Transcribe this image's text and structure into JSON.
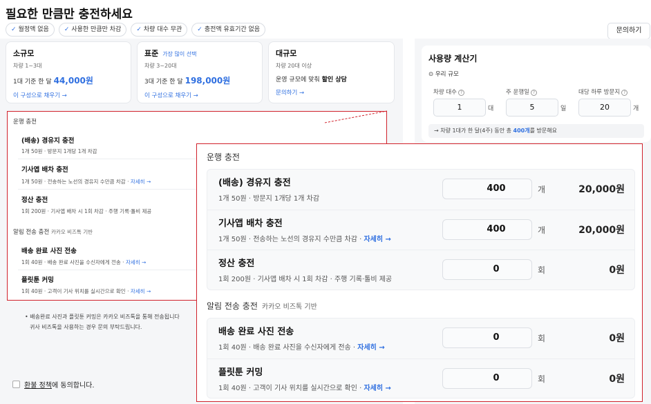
{
  "header": {
    "title": "필요한 만큼만 충전하세요",
    "inquiry_button": "문의하기",
    "chips": [
      "월정액 없음",
      "사용한 만큼만 차감",
      "차량 대수 무관",
      "충전액 유효기간 없음"
    ]
  },
  "plans": [
    {
      "name": "소규모",
      "badge": "",
      "sub": "차량 1~3대",
      "price_prefix": "1대 기준 한 달",
      "price": "44,000원",
      "price_strong": "",
      "link": "이 구성으로 채우기 →"
    },
    {
      "name": "표준",
      "badge": "가장 많이 선택",
      "sub": "차량 3~20대",
      "price_prefix": "3대 기준 한 달",
      "price": "198,000원",
      "price_strong": "",
      "link": "이 구성으로 채우기 →"
    },
    {
      "name": "대규모",
      "badge": "",
      "sub": "차량 20대 이상",
      "price_prefix": "운영 규모에 맞춰",
      "price": "",
      "price_strong": "할인 상담",
      "link": "문의하기 →"
    }
  ],
  "calculator": {
    "title": "사용량 계산기",
    "scope_label": "우리 규모",
    "fields": [
      {
        "label": "차량 대수",
        "value": "1",
        "unit": "대"
      },
      {
        "label": "주 운행일",
        "value": "5",
        "unit": "일"
      },
      {
        "label": "대당 하루 방문지",
        "value": "20",
        "unit": "개"
      }
    ],
    "summary_prefix": "→ 차량 1대가 한 달(4주) 동안 총",
    "summary_count": "400개",
    "summary_suffix": "를 방문해요"
  },
  "sections": {
    "operation_title": "운행 충전",
    "notify_title": "알림 전송 충전",
    "notify_sub": "카카오 비즈톡 기반"
  },
  "operation_items": [
    {
      "title": "(배송) 경유지 충전",
      "desc": "1개 50원 · 방문지 1개당 1개 차감",
      "link": "",
      "value": "400",
      "unit": "개",
      "amount": "20,000원"
    },
    {
      "title": "기사앱 배차 충전",
      "desc": "1개 50원 · 전송하는 노선의 경유지 수만큼 차감 ·",
      "link": "자세히 →",
      "value": "400",
      "unit": "개",
      "amount": "20,000원"
    },
    {
      "title": "정산 충전",
      "desc": "1회 200원 · 기사앱 배차 시 1회 차감 · 주행 기록·톨비 제공",
      "link": "",
      "value": "0",
      "unit": "회",
      "amount": "0원"
    }
  ],
  "notify_items": [
    {
      "title": "배송 완료 사진 전송",
      "desc": "1회 40원 · 배송 완료 사진을 수신자에게 전송 ·",
      "link": "자세히 →",
      "value": "0",
      "unit": "회",
      "amount": "0원"
    },
    {
      "title": "플릿툰 커밍",
      "desc": "1회 40원 · 고객이 기사 위치를 실시간으로 확인 ·",
      "link": "자세히 →",
      "value": "0",
      "unit": "회",
      "amount": "0원"
    }
  ],
  "small_preview": {
    "partial_value": "400",
    "partial_amount": "20,000원"
  },
  "note": {
    "line1": "배송완료 사진과 플릿툰 커밍은 카카오 비즈톡을 통해 전송됩니다",
    "line2": "귀사 비즈톡을 사용하는 경우 문의 부탁드립니다."
  },
  "agreement": {
    "link": "환불 정책",
    "suffix": "에 동의합니다."
  },
  "colors": {
    "accent": "#2f6fe0",
    "highlight_border": "#d0202a"
  }
}
